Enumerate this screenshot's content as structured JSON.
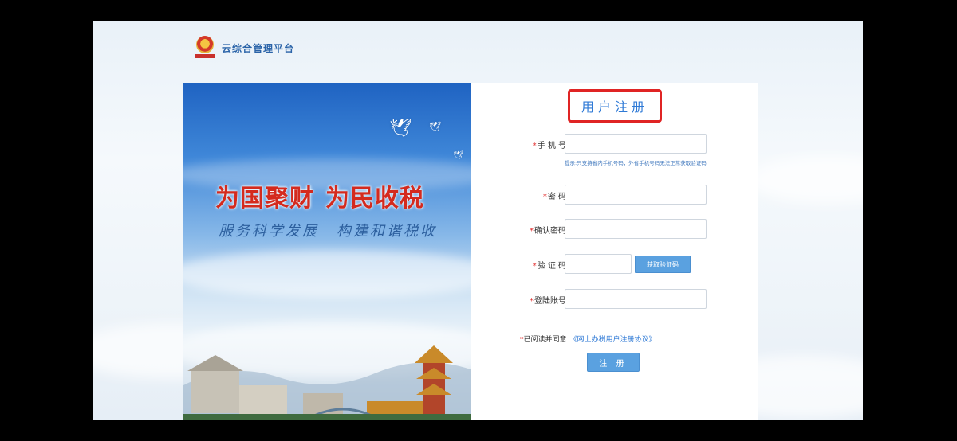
{
  "header": {
    "brand": "云综合管理平台",
    "emblem_icon": "tax-emblem-icon"
  },
  "banner": {
    "slogan_part1": "为国聚财",
    "slogan_part2": "为民收税",
    "subslogan_part1": "服务科学发展",
    "subslogan_part2": "构建和谐税收"
  },
  "form": {
    "title": "用户注册",
    "fields": {
      "phone": {
        "label": "手 机 号",
        "value": ""
      },
      "phone_hint": "提示:只支持省内手机号码，外省手机号码无法正常获取验证码",
      "password": {
        "label": "密    码",
        "value": ""
      },
      "confirm": {
        "label": "确认密码",
        "value": ""
      },
      "captcha": {
        "label": "验 证 码",
        "value": ""
      },
      "account": {
        "label": "登陆账号",
        "value": ""
      }
    },
    "get_code_label": "获取验证码",
    "agree_prefix": "已阅读并同意",
    "agreement_link": "《网上办税用户注册协议》",
    "submit_label": "注 册"
  },
  "colors": {
    "accent": "#2f7ad6",
    "required": "#e02424",
    "button": "#5aa1e0",
    "highlight_box": "#e02424"
  }
}
